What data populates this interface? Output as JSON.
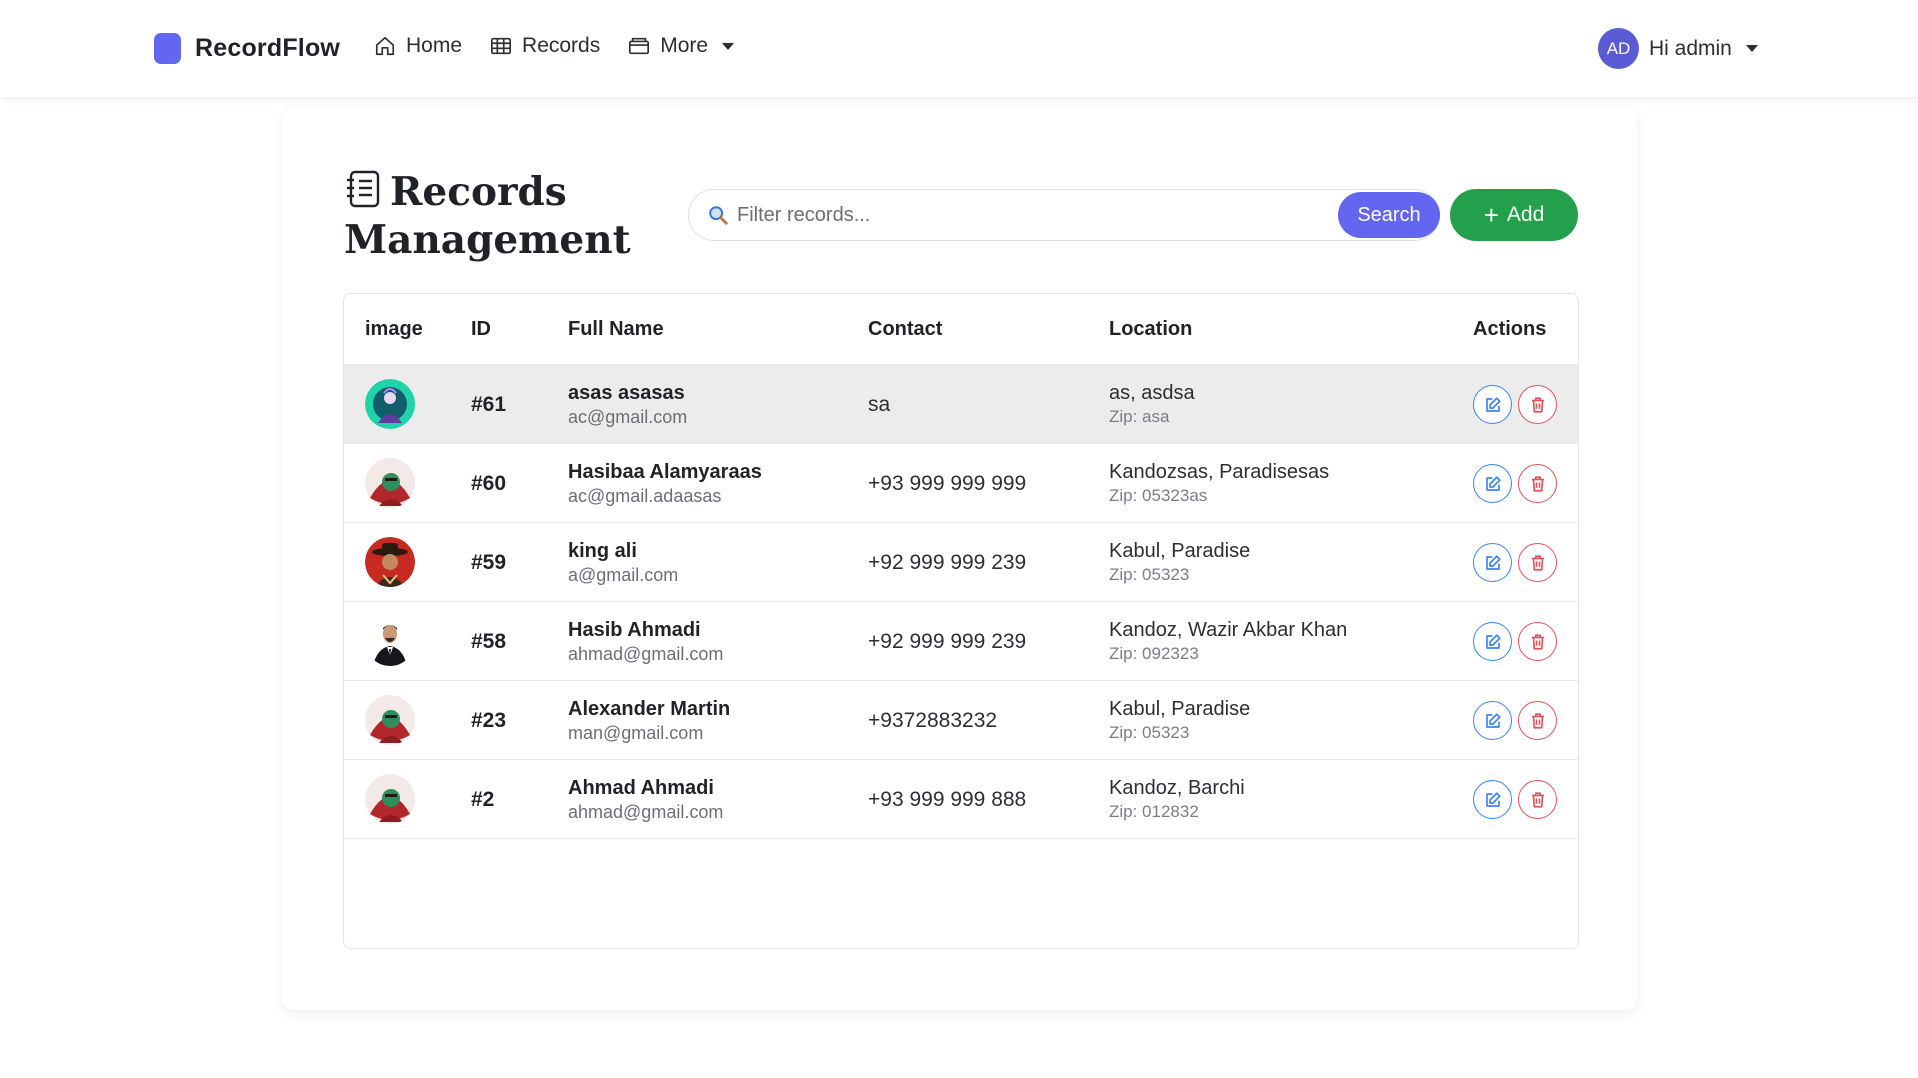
{
  "brand": {
    "name": "RecordFlow",
    "logo_color": "#6366f1"
  },
  "nav": {
    "items": [
      {
        "label": "Home",
        "icon": "home-icon"
      },
      {
        "label": "Records",
        "icon": "table-icon"
      },
      {
        "label": "More",
        "icon": "folder-icon",
        "dropdown": true
      }
    ]
  },
  "user": {
    "initials": "AD",
    "greeting": "Hi admin"
  },
  "page": {
    "title": "Records Management",
    "title_line1": "Records",
    "title_line2": "Management"
  },
  "search": {
    "placeholder": "Filter records...",
    "value": "",
    "button_label": "Search"
  },
  "add_button": {
    "label": "Add"
  },
  "table": {
    "headers": {
      "image": "image",
      "id": "ID",
      "name": "Full Name",
      "contact": "Contact",
      "location": "Location",
      "actions": "Actions"
    },
    "rows": [
      {
        "id": "#61",
        "name": "asas asasas",
        "email": "ac@gmail.com",
        "contact": "sa",
        "location": "as, asdsa",
        "zip": "Zip: asa",
        "avatar": "teal-person",
        "highlighted": true
      },
      {
        "id": "#60",
        "name": "Hasibaa Alamyaraas",
        "email": "ac@gmail.adaasas",
        "contact": "+93 999 999 999",
        "location": "Kandozsas, Paradisesas",
        "zip": "Zip: 05323as",
        "avatar": "red-green-portrait",
        "highlighted": false
      },
      {
        "id": "#59",
        "name": "king ali",
        "email": "a@gmail.com",
        "contact": "+92 999 999 239",
        "location": "Kabul, Paradise",
        "zip": "Zip: 05323",
        "avatar": "cowboy-portrait",
        "highlighted": false
      },
      {
        "id": "#58",
        "name": "Hasib Ahmadi",
        "email": "ahmad@gmail.com",
        "contact": "+92 999 999 239",
        "location": "Kandoz, Wazir Akbar Khan",
        "zip": "Zip: 092323",
        "avatar": "suit-man-photo",
        "highlighted": false
      },
      {
        "id": "#23",
        "name": "Alexander Martin",
        "email": "man@gmail.com",
        "contact": "+9372883232",
        "location": "Kabul, Paradise",
        "zip": "Zip: 05323",
        "avatar": "red-green-portrait",
        "highlighted": false
      },
      {
        "id": "#2",
        "name": "Ahmad Ahmadi",
        "email": "ahmad@gmail.com",
        "contact": "+93 999 999 888",
        "location": "Kandoz, Barchi",
        "zip": "Zip: 012832",
        "avatar": "red-green-portrait",
        "highlighted": false
      }
    ]
  },
  "colors": {
    "primary": "#6366f1",
    "success": "#22a04b",
    "edit": "#3b82f6",
    "delete": "#e0525c",
    "highlight_row": "#ececec"
  }
}
